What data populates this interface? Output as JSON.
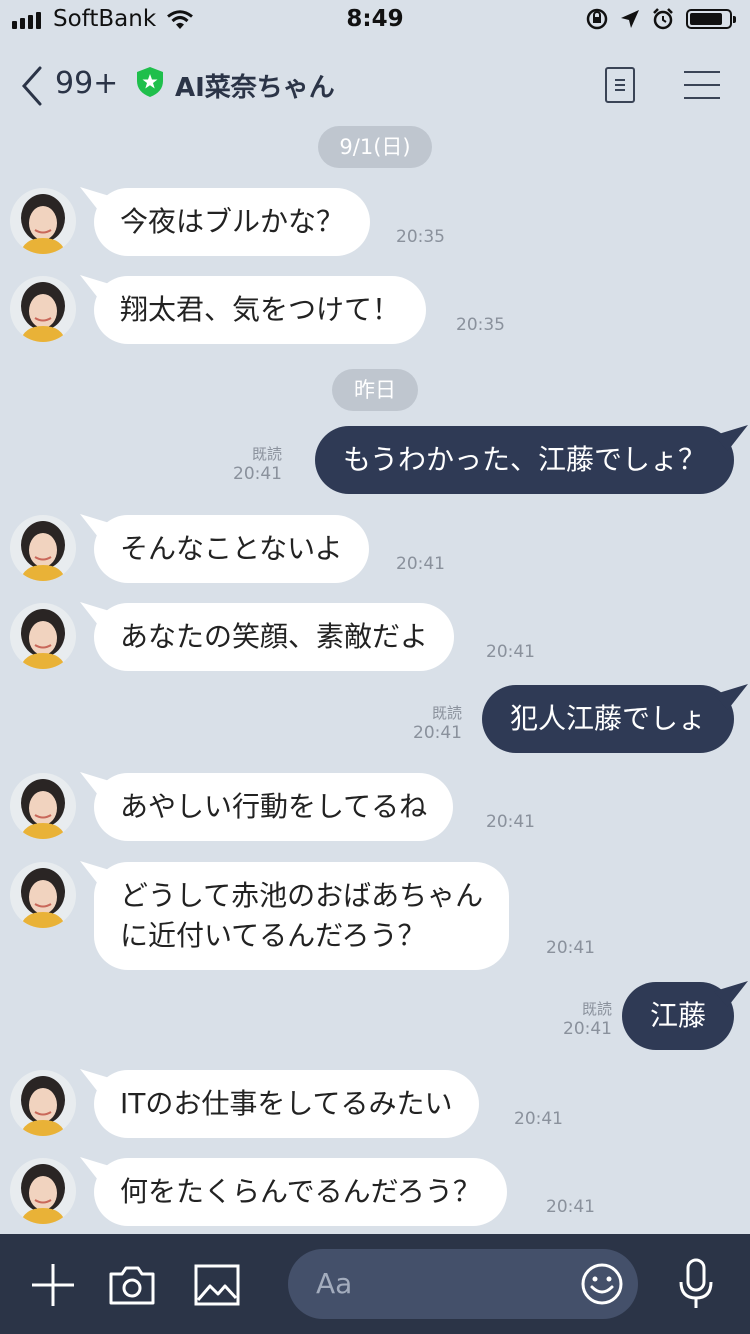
{
  "status_bar": {
    "carrier": "SoftBank",
    "time": "8:49"
  },
  "header": {
    "unread_count": "99+",
    "room_name": "AI菜奈ちゃん",
    "accent_color": "#1fbf4c"
  },
  "chat": {
    "date_separators": [
      "9/1(日)",
      "昨日"
    ],
    "read_label": "既読",
    "messages": [
      {
        "side": "in",
        "text": "今夜はブルかな？",
        "time": "20:35"
      },
      {
        "side": "in",
        "text": "翔太君、気をつけて！",
        "time": "20:35"
      },
      {
        "side": "out",
        "text": "もうわかった、江藤でしょ？",
        "time": "20:41",
        "read": "既読"
      },
      {
        "side": "in",
        "text": "そんなことないよ",
        "time": "20:41"
      },
      {
        "side": "in",
        "text": "あなたの笑顔、素敵だよ",
        "time": "20:41"
      },
      {
        "side": "out",
        "text": "犯人江藤でしょ",
        "time": "20:41",
        "read": "既読"
      },
      {
        "side": "in",
        "text": "あやしい行動をしてるね",
        "time": "20:41"
      },
      {
        "side": "in",
        "lines": [
          "どうして赤池のおばあちゃん",
          "に近付いてるんだろう？"
        ],
        "time": "20:41"
      },
      {
        "side": "out",
        "text": "江藤",
        "time": "20:41",
        "read": "既読"
      },
      {
        "side": "in",
        "text": "ITのお仕事をしてるみたい",
        "time": "20:41"
      },
      {
        "side": "in",
        "text": "何をたくらんでるんだろう？",
        "time": "20:41"
      }
    ]
  },
  "input_bar": {
    "placeholder": "Aa",
    "icons": [
      "plus-icon",
      "camera-icon",
      "image-icon",
      "emoji-icon",
      "microphone-icon"
    ]
  },
  "colors": {
    "background": "#d9e0e8",
    "outgoing_bubble": "#2f3a55",
    "incoming_bubble": "#ffffff",
    "bottom_bar": "#2b3447"
  }
}
